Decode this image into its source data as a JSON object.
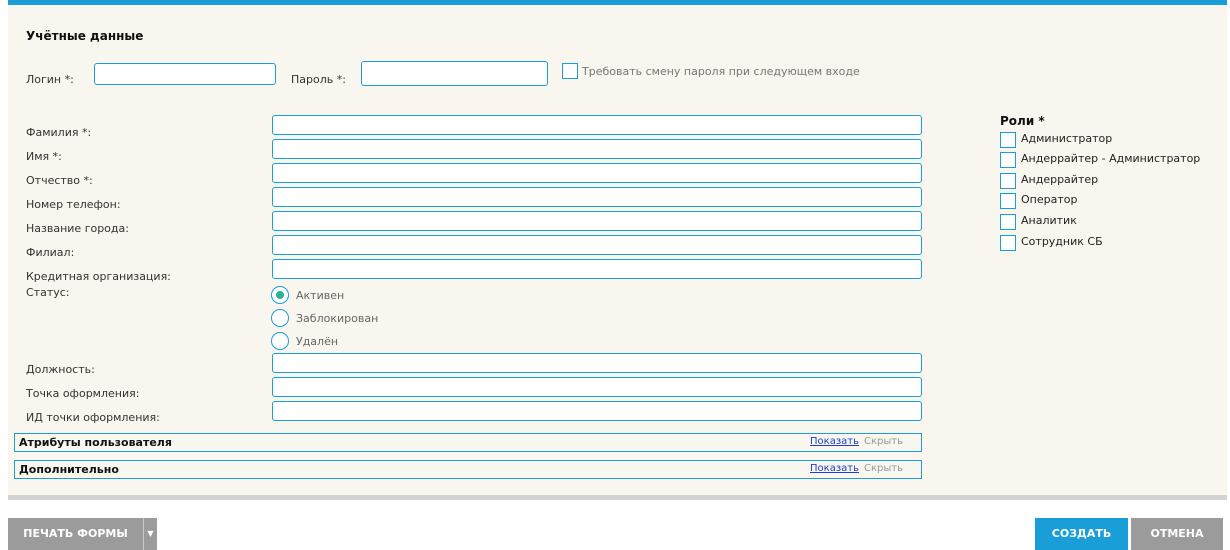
{
  "credentials": {
    "title": "Учётные данные",
    "login_label": "Логин *:",
    "login_value": "",
    "password_label": "Пароль *:",
    "password_value": "",
    "require_change_label": "Требовать смену пароля при следующем входе"
  },
  "fields": [
    {
      "label": "Фамилия *:",
      "value": ""
    },
    {
      "label": "Имя *:",
      "value": ""
    },
    {
      "label": "Отчество *:",
      "value": ""
    },
    {
      "label": "Номер телефон:",
      "value": ""
    },
    {
      "label": "Название города:",
      "value": ""
    },
    {
      "label": "Филиал:",
      "value": ""
    },
    {
      "label": "Кредитная организация:",
      "value": ""
    }
  ],
  "status": {
    "label": "Статус:",
    "options": [
      "Активен",
      "Заблокирован",
      "Удалён"
    ],
    "selected": "Активен"
  },
  "fields2": [
    {
      "label": "Должность:",
      "value": ""
    },
    {
      "label": "Точка оформления:",
      "value": ""
    },
    {
      "label": "ИД точки оформления:",
      "value": ""
    }
  ],
  "sections": [
    {
      "title": "Атрибуты пользователя",
      "show": "Показать",
      "hide": "Скрыть"
    },
    {
      "title": "Дополнительно",
      "show": "Показать",
      "hide": "Скрыть"
    }
  ],
  "roles": {
    "title": "Роли *",
    "items": [
      "Администратор",
      "Андеррайтер - Администратор",
      "Андеррайтер",
      "Оператор",
      "Аналитик",
      "Сотрудник СБ"
    ]
  },
  "footer": {
    "print_label": "ПЕЧАТЬ ФОРМЫ",
    "create_label": "СОЗДАТЬ",
    "cancel_label": "ОТМЕНА"
  },
  "colors": {
    "accent": "#1a9ed8",
    "radio_checked": "#2bb39a",
    "panel_bg": "#f9f5ef",
    "secondary_button": "#9b9b9b"
  }
}
